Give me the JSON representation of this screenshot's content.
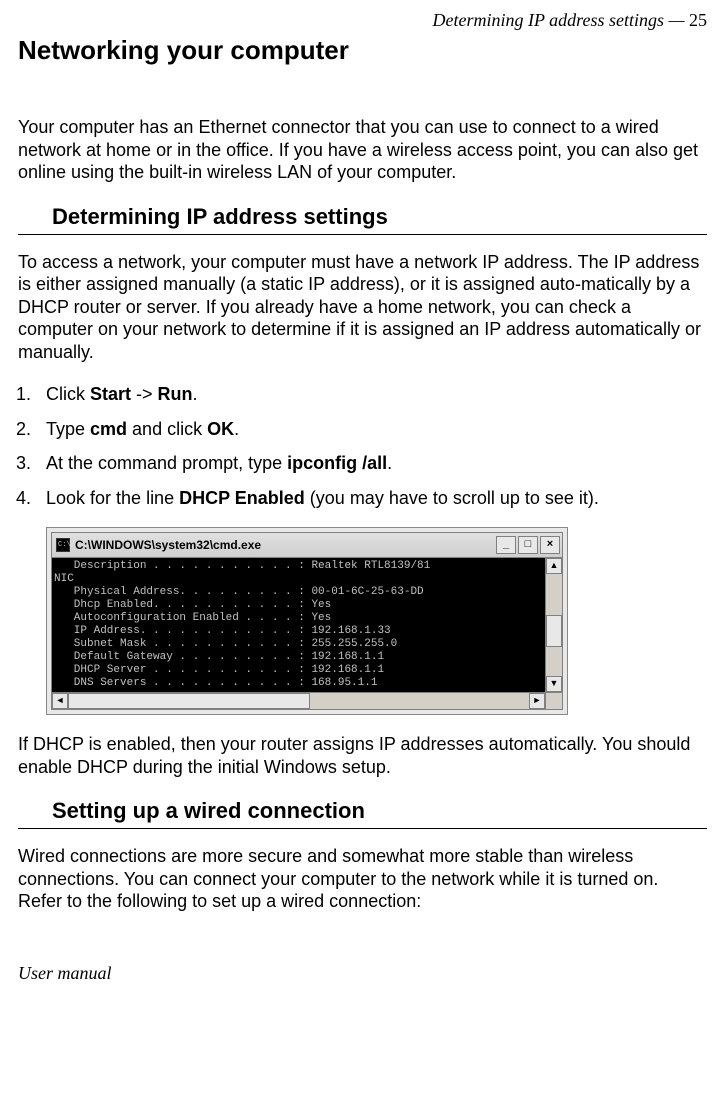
{
  "header": {
    "running": "Determining IP address settings —  ",
    "page": "25"
  },
  "title": "Networking your computer",
  "intro": "Your computer has an Ethernet connector that you can use to connect to a wired network at home or in the office. If you have a wireless access point, you can also get online using the built-in wireless LAN of your computer.",
  "section1": {
    "heading": "Determining IP address settings",
    "para": "To access a network, your computer must have a network IP address. The IP address is either assigned manually (a static IP address), or it is assigned auto-matically by a DHCP router or server. If you already have a home network, you can check a computer on your network to determine if it is assigned an IP address automatically or manually.",
    "steps": {
      "s1a": "Click ",
      "s1b": "Start",
      "s1c": " -> ",
      "s1d": "Run",
      "s1e": ".",
      "s2a": "Type ",
      "s2b": "cmd",
      "s2c": " and click ",
      "s2d": "OK",
      "s2e": ".",
      "s3a": "At the command prompt, type ",
      "s3b": "ipconfig /all",
      "s3c": ".",
      "s4a": "Look for the line ",
      "s4b": "DHCP Enabled",
      "s4c": " (you may have to scroll up to see it)."
    },
    "after": "If DHCP is enabled, then your router assigns IP addresses automatically. You should enable DHCP during the initial Windows setup."
  },
  "cmd": {
    "title": "C:\\WINDOWS\\system32\\cmd.exe",
    "btn_min": "_",
    "btn_max": "□",
    "btn_close": "×",
    "content": "   Description . . . . . . . . . . . : Realtek RTL8139/81\nNIC\n   Physical Address. . . . . . . . . : 00-01-6C-25-63-DD\n   Dhcp Enabled. . . . . . . . . . . : Yes\n   Autoconfiguration Enabled . . . . : Yes\n   IP Address. . . . . . . . . . . . : 192.168.1.33\n   Subnet Mask . . . . . . . . . . . : 255.255.255.0\n   Default Gateway . . . . . . . . . : 192.168.1.1\n   DHCP Server . . . . . . . . . . . : 192.168.1.1\n   DNS Servers . . . . . . . . . . . : 168.95.1.1",
    "scroll_up": "▲",
    "scroll_down": "▼",
    "scroll_left": "◄",
    "scroll_right": "►"
  },
  "section2": {
    "heading": "Setting up a wired connection",
    "para": "Wired connections are more secure and somewhat more stable than wireless connections. You can connect your computer to the network while it is turned on. Refer to the following to set up a wired connection:"
  },
  "footer": "User manual"
}
